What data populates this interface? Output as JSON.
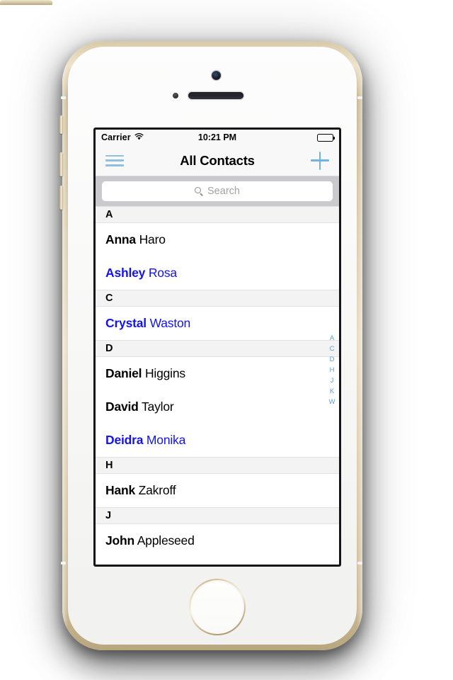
{
  "device": {
    "name": "iphone-5s-gold",
    "frame_color": "#d9c9a4",
    "front_color": "#fbfbfa"
  },
  "status_bar": {
    "carrier": "Carrier",
    "wifi_icon": "wifi-icon",
    "time": "10:21 PM",
    "battery_icon": "battery-full-icon"
  },
  "nav_bar": {
    "menu_icon": "hamburger-menu-icon",
    "title": "All Contacts",
    "add_icon": "plus-icon",
    "tint_color": "#6fb4de"
  },
  "search": {
    "icon": "search-icon",
    "placeholder": "Search",
    "value": ""
  },
  "sections": [
    {
      "letter": "A",
      "contacts": [
        {
          "first": "Anna",
          "last": " Haro",
          "color": "black"
        },
        {
          "first": "Ashley",
          "last": " Rosa",
          "color": "blue"
        }
      ]
    },
    {
      "letter": "C",
      "contacts": [
        {
          "first": "Crystal",
          "last": " Waston",
          "color": "blue"
        }
      ]
    },
    {
      "letter": "D",
      "contacts": [
        {
          "first": "Daniel",
          "last": " Higgins",
          "color": "black"
        },
        {
          "first": "David",
          "last": " Taylor",
          "color": "black"
        },
        {
          "first": "Deidra",
          "last": " Monika",
          "color": "blue"
        }
      ]
    },
    {
      "letter": "H",
      "contacts": [
        {
          "first": "Hank",
          "last": " Zakroff",
          "color": "black"
        }
      ]
    },
    {
      "letter": "J",
      "contacts": [
        {
          "first": "John",
          "last": " Appleseed",
          "color": "black"
        }
      ]
    }
  ],
  "section_index": [
    "A",
    "C",
    "D",
    "H",
    "J",
    "K",
    "W"
  ],
  "colors": {
    "contact_highlight": "#1414f0",
    "contact_default": "#000000",
    "index_tint": "#5b9fd6",
    "section_header_bg": "#f3f3f3",
    "search_bar_bg": "#c9c9ce",
    "nav_bg": "#f8f8f8"
  }
}
